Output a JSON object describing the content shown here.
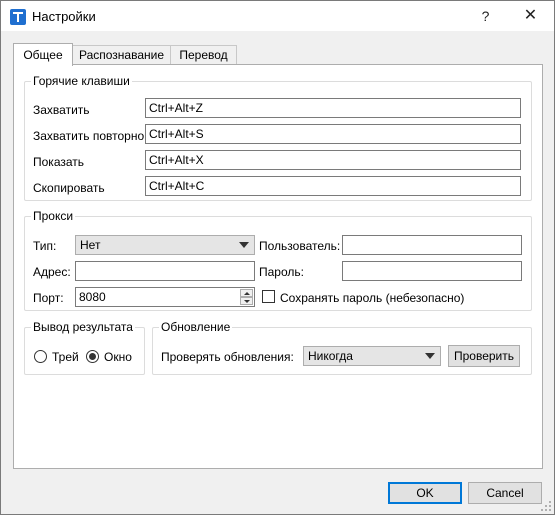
{
  "window": {
    "title": "Настройки",
    "help_glyph": "?",
    "close_glyph": "✕"
  },
  "tabs": [
    {
      "label": "Общее",
      "active": true
    },
    {
      "label": "Распознавание",
      "active": false
    },
    {
      "label": "Перевод",
      "active": false
    }
  ],
  "hotkeys": {
    "legend": "Горячие клавиши",
    "capture_label": "Захватить",
    "capture_value": "Ctrl+Alt+Z",
    "recapture_label": "Захватить повторно",
    "recapture_value": "Ctrl+Alt+S",
    "show_label": "Показать",
    "show_value": "Ctrl+Alt+X",
    "copy_label": "Скопировать",
    "copy_value": "Ctrl+Alt+C"
  },
  "proxy": {
    "legend": "Прокси",
    "type_label": "Тип:",
    "type_value": "Нет",
    "user_label": "Пользователь:",
    "user_value": "",
    "address_label": "Адрес:",
    "address_value": "",
    "password_label": "Пароль:",
    "password_value": "",
    "port_label": "Порт:",
    "port_value": "8080",
    "save_password_label": "Сохранять пароль (небезопасно)",
    "save_password_checked": false
  },
  "output": {
    "legend": "Вывод результата",
    "tray_label": "Трей",
    "tray_checked": false,
    "window_label": "Окно",
    "window_checked": true
  },
  "update": {
    "legend": "Обновление",
    "check_label": "Проверять обновления:",
    "frequency_value": "Никогда",
    "check_button": "Проверить"
  },
  "footer": {
    "ok_label": "OK",
    "cancel_label": "Cancel"
  },
  "colors": {
    "window_bg": "#f0f0f0",
    "panel_bg": "#ffffff",
    "focus_accent": "#0078d7"
  },
  "icons": {
    "app": "app-logo-icon",
    "help": "help-icon",
    "close": "close-icon"
  }
}
